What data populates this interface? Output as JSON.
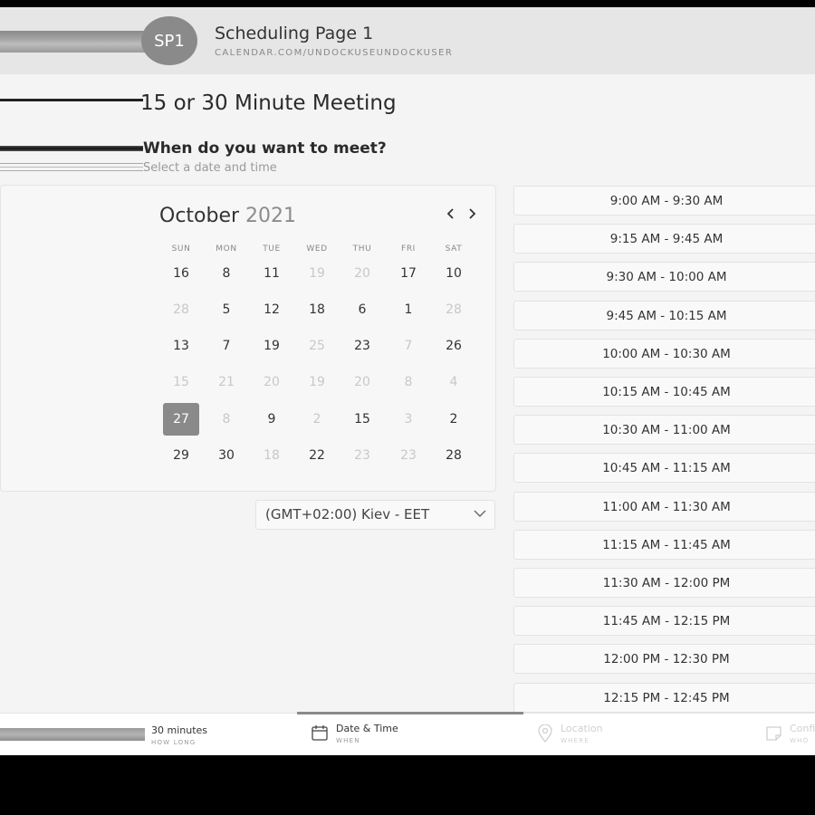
{
  "header": {
    "avatar_initials": "SP1",
    "title": "Scheduling Page 1",
    "url": "CALENDAR.COM/UNDOCKUSEUNDOCKUSER"
  },
  "page_title": "15 or 30 Minute Meeting",
  "section": {
    "question": "When do you want to meet?",
    "subtitle": "Select a date and time"
  },
  "calendar": {
    "month": "October",
    "year": "2021",
    "prev_icon": "‹",
    "next_icon": "›",
    "weekdays": [
      "SUN",
      "MON",
      "TUE",
      "WED",
      "THU",
      "FRI",
      "SAT"
    ],
    "weeks": [
      [
        {
          "d": "16",
          "muted": false
        },
        {
          "d": "8",
          "muted": false
        },
        {
          "d": "11",
          "muted": false
        },
        {
          "d": "19",
          "muted": true
        },
        {
          "d": "20",
          "muted": true
        },
        {
          "d": "17",
          "muted": false
        },
        {
          "d": "10",
          "muted": false
        }
      ],
      [
        {
          "d": "28",
          "muted": true
        },
        {
          "d": "5",
          "muted": false
        },
        {
          "d": "12",
          "muted": false
        },
        {
          "d": "18",
          "muted": false
        },
        {
          "d": "6",
          "muted": false
        },
        {
          "d": "1",
          "muted": false
        },
        {
          "d": "28",
          "muted": true
        }
      ],
      [
        {
          "d": "13",
          "muted": false
        },
        {
          "d": "7",
          "muted": false
        },
        {
          "d": "19",
          "muted": false
        },
        {
          "d": "25",
          "muted": true
        },
        {
          "d": "23",
          "muted": false
        },
        {
          "d": "7",
          "muted": true
        },
        {
          "d": "26",
          "muted": false
        }
      ],
      [
        {
          "d": "15",
          "muted": true
        },
        {
          "d": "21",
          "muted": true
        },
        {
          "d": "20",
          "muted": true
        },
        {
          "d": "19",
          "muted": true
        },
        {
          "d": "20",
          "muted": true
        },
        {
          "d": "8",
          "muted": true
        },
        {
          "d": "4",
          "muted": true
        }
      ],
      [
        {
          "d": "27",
          "muted": false,
          "selected": true
        },
        {
          "d": "8",
          "muted": true
        },
        {
          "d": "9",
          "muted": false
        },
        {
          "d": "2",
          "muted": true
        },
        {
          "d": "15",
          "muted": false
        },
        {
          "d": "3",
          "muted": true
        },
        {
          "d": "2",
          "muted": false
        }
      ],
      [
        {
          "d": "29",
          "muted": false
        },
        {
          "d": "30",
          "muted": false
        },
        {
          "d": "18",
          "muted": true
        },
        {
          "d": "22",
          "muted": false
        },
        {
          "d": "23",
          "muted": true
        },
        {
          "d": "23",
          "muted": true
        },
        {
          "d": "28",
          "muted": false
        }
      ]
    ]
  },
  "timezone": {
    "label": "(GMT+02:00) Kiev - EET",
    "icon": "chevron-down-icon"
  },
  "time_slots": [
    "9:00 AM - 9:30 AM",
    "9:15 AM - 9:45 AM",
    "9:30 AM - 10:00 AM",
    "9:45 AM - 10:15 AM",
    "10:00 AM - 10:30 AM",
    "10:15 AM - 10:45 AM",
    "10:30 AM - 11:00 AM",
    "10:45 AM - 11:15 AM",
    "11:00 AM - 11:30 AM",
    "11:15 AM - 11:45 AM",
    "11:30 AM - 12:00 PM",
    "11:45 AM - 12:15 PM",
    "12:00 PM - 12:30 PM",
    "12:15 PM - 12:45 PM"
  ],
  "footer": {
    "duration": {
      "title": "30 minutes",
      "sub": "HOW LONG"
    },
    "datetime": {
      "title": "Date & Time",
      "sub": "WHEN",
      "icon": "calendar-icon"
    },
    "location": {
      "title": "Location",
      "sub": "WHERE",
      "icon": "location-pin-icon"
    },
    "confirm": {
      "title": "Confirm",
      "sub": "WHO",
      "icon": "note-icon"
    }
  },
  "colors": {
    "accent": "#8a8a8a",
    "background": "#f4f4f4",
    "header": "#e6e6e6"
  }
}
